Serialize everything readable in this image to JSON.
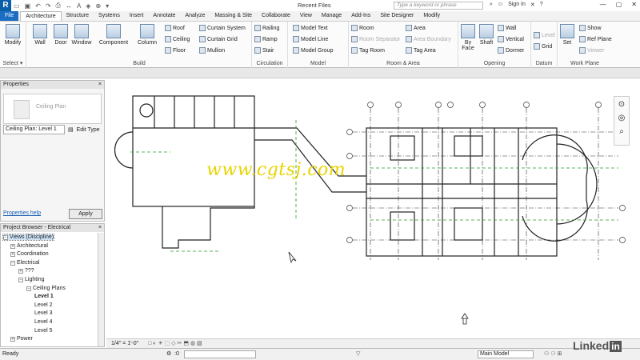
{
  "app": {
    "logo": "R",
    "title": "Recent Files",
    "search_placeholder": "Type a keyword or phrase",
    "signin": "Sign In",
    "help": "?"
  },
  "tabs": [
    "File",
    "Architecture",
    "Structure",
    "Systems",
    "Insert",
    "Annotate",
    "Analyze",
    "Massing & Site",
    "Collaborate",
    "View",
    "Manage",
    "Add-Ins",
    "Site Designer",
    "Modify"
  ],
  "active_tab": "Architecture",
  "ribbon": {
    "select": {
      "modify": "Modify",
      "title": "Select ▾"
    },
    "build": {
      "wall": "Wall",
      "door": "Door",
      "window": "Window",
      "component": "Component",
      "column": "Column",
      "roof": "Roof",
      "ceiling": "Ceiling",
      "floor": "Floor",
      "curtain_system": "Curtain System",
      "curtain_grid": "Curtain Grid",
      "mullion": "Mullion",
      "title": "Build"
    },
    "circulation": {
      "railing": "Railing",
      "ramp": "Ramp",
      "stair": "Stair",
      "title": "Circulation"
    },
    "model": {
      "text": "Model Text",
      "line": "Model Line",
      "group": "Model Group",
      "title": "Model"
    },
    "room_area": {
      "room": "Room",
      "room_separator": "Room Separator",
      "tag_room": "Tag Room",
      "area": "Area",
      "area_boundary": "Area Boundary",
      "tag_area": "Tag Area",
      "title": "Room & Area"
    },
    "opening": {
      "by_face": "By Face",
      "shaft": "Shaft",
      "wall": "Wall",
      "vertical": "Vertical",
      "dormer": "Dormer",
      "title": "Opening"
    },
    "datum": {
      "level": "Level",
      "grid": "Grid",
      "title": "Datum"
    },
    "work_plane": {
      "set": "Set",
      "show": "Show",
      "ref_plane": "Ref Plane",
      "viewer": "Viewer",
      "title": "Work Plane"
    }
  },
  "properties": {
    "title": "Properties",
    "close": "×",
    "type_name": "Ceiling Plan",
    "selector": "Ceiling Plan: Level 1",
    "edit_type": "Edit Type",
    "help": "Properties help",
    "apply": "Apply"
  },
  "browser": {
    "title": "Project Browser - Electrical",
    "items": [
      {
        "label": "Views (Discipline)",
        "exp": "−"
      },
      {
        "label": "Architectural",
        "exp": "+"
      },
      {
        "label": "Coordination",
        "exp": "+"
      },
      {
        "label": "Electrical",
        "exp": "−"
      },
      {
        "label": "???",
        "exp": "+"
      },
      {
        "label": "Lighting",
        "exp": "−"
      },
      {
        "label": "Ceiling Plans",
        "exp": "−"
      },
      {
        "label": "Level 1",
        "exp": ""
      },
      {
        "label": "Level 2",
        "exp": ""
      },
      {
        "label": "Level 3",
        "exp": ""
      },
      {
        "label": "Level 4",
        "exp": ""
      },
      {
        "label": "Level 5",
        "exp": ""
      },
      {
        "label": "Power",
        "exp": "+"
      }
    ]
  },
  "view_bar": {
    "scale": "1/4\" = 1'-0\""
  },
  "status": {
    "ready": "Ready",
    "zero": ":0",
    "model": "Main Model"
  },
  "watermark": "www.cgtsj.com",
  "brand": {
    "text": "Linked",
    "in": "in"
  },
  "colors": {
    "file_tab": "#1b6ec2",
    "grid_green": "#2a9a2a",
    "watermark": "#e8d400"
  }
}
